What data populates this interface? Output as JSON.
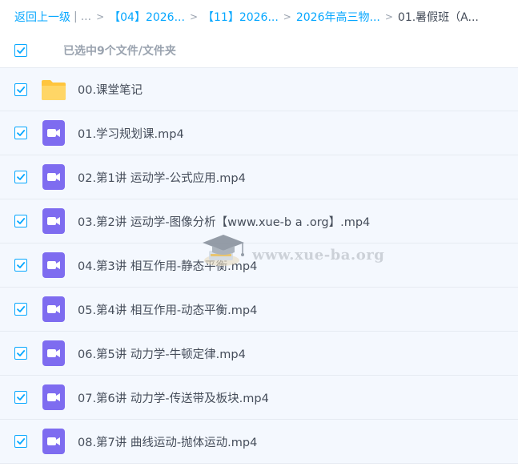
{
  "breadcrumb": {
    "back_label": "返回上一级",
    "ellipsis": "...",
    "items": [
      {
        "label": "【04】2026..."
      },
      {
        "label": "【11】2026..."
      },
      {
        "label": "2026年高三物..."
      }
    ],
    "current": "01.暑假班（A..."
  },
  "selection": {
    "text": "已选中9个文件/文件夹"
  },
  "files": [
    {
      "name": "00.课堂笔记",
      "type": "folder-icon"
    },
    {
      "name": "01.学习规划课.mp4",
      "type": "video-icon"
    },
    {
      "name": "02.第1讲 运动学-公式应用.mp4",
      "type": "video-icon"
    },
    {
      "name": "03.第2讲 运动学-图像分析【www.xue-b a .org】.mp4",
      "type": "video-icon"
    },
    {
      "name": "04.第3讲 相互作用-静态平衡.mp4",
      "type": "video-icon"
    },
    {
      "name": "05.第4讲 相互作用-动态平衡.mp4",
      "type": "video-icon"
    },
    {
      "name": "06.第5讲 动力学-牛顿定律.mp4",
      "type": "video-icon"
    },
    {
      "name": "07.第6讲 动力学-传送带及板块.mp4",
      "type": "video-icon"
    },
    {
      "name": "08.第7讲 曲线运动-抛体运动.mp4",
      "type": "video-icon"
    }
  ],
  "watermark": {
    "text": "www.xue-ba.org"
  },
  "colors": {
    "accent": "#06a7ff",
    "row_selected_bg": "#f4f8fe",
    "video_icon": "#7e6cf0",
    "folder_icon": "#ffc53d"
  }
}
